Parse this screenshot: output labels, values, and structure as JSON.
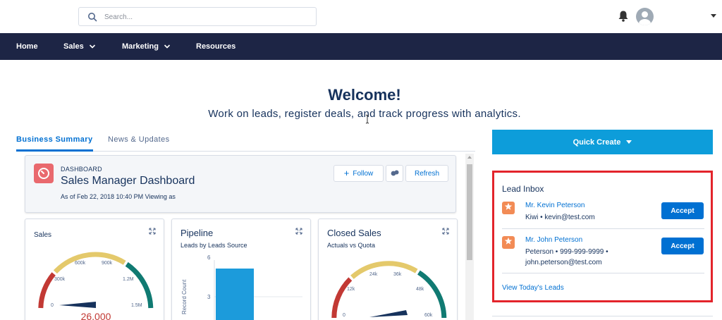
{
  "search": {
    "placeholder": "Search..."
  },
  "nav": {
    "items": [
      {
        "label": "Home"
      },
      {
        "label": "Sales"
      },
      {
        "label": "Marketing"
      },
      {
        "label": "Resources"
      }
    ]
  },
  "welcome": {
    "title": "Welcome!",
    "subtitle": "Work on leads, register deals, and track progress with analytics."
  },
  "tabs": [
    {
      "label": "Business Summary",
      "active": true
    },
    {
      "label": "News & Updates",
      "active": false
    }
  ],
  "dashboard": {
    "eyebrow": "DASHBOARD",
    "title": "Sales Manager Dashboard",
    "meta": "As of Feb 22, 2018 10:40 PM Viewing as",
    "follow_label": "Follow",
    "refresh_label": "Refresh"
  },
  "cards": [
    {
      "title": "Sales",
      "subtitle": "",
      "gauge": {
        "ticks": [
          "0",
          "300k",
          "600k",
          "900k",
          "1.2M",
          "1.5M"
        ],
        "value_label": "26,000",
        "value": 26000,
        "max": 1500000,
        "colors": [
          "#c23934",
          "#e4c96b",
          "#107a72"
        ]
      }
    },
    {
      "title": "Pipeline",
      "subtitle": "Leads by Leads Source",
      "ylabel": "Record Count",
      "y_ticks": [
        "6",
        "3"
      ],
      "bar_color": "#1c9bdb"
    },
    {
      "title": "Closed Sales",
      "subtitle": "Actuals vs Quota",
      "gauge": {
        "ticks": [
          "0",
          "12k",
          "24k",
          "36k",
          "48k",
          "60k"
        ],
        "colors": [
          "#c23934",
          "#e4c96b",
          "#107a72"
        ]
      }
    }
  ],
  "quick_create": {
    "label": "Quick Create"
  },
  "lead_inbox": {
    "title": "Lead Inbox",
    "leads": [
      {
        "name": "Mr. Kevin Peterson",
        "detail": "Kiwi • kevin@test.com",
        "accept_label": "Accept"
      },
      {
        "name": "Mr. John Peterson",
        "detail": "Peterson • 999-999-9999 • john.peterson@test.com",
        "accept_label": "Accept"
      }
    ],
    "view_link": "View Today's Leads"
  },
  "colors": {
    "nav_bg": "#1d2545",
    "accent": "#0070d2",
    "quick_create": "#0d9dda",
    "highlight_border": "#e3242b",
    "lead_icon": "#f28b55",
    "dashboard_icon": "#e9696e"
  }
}
